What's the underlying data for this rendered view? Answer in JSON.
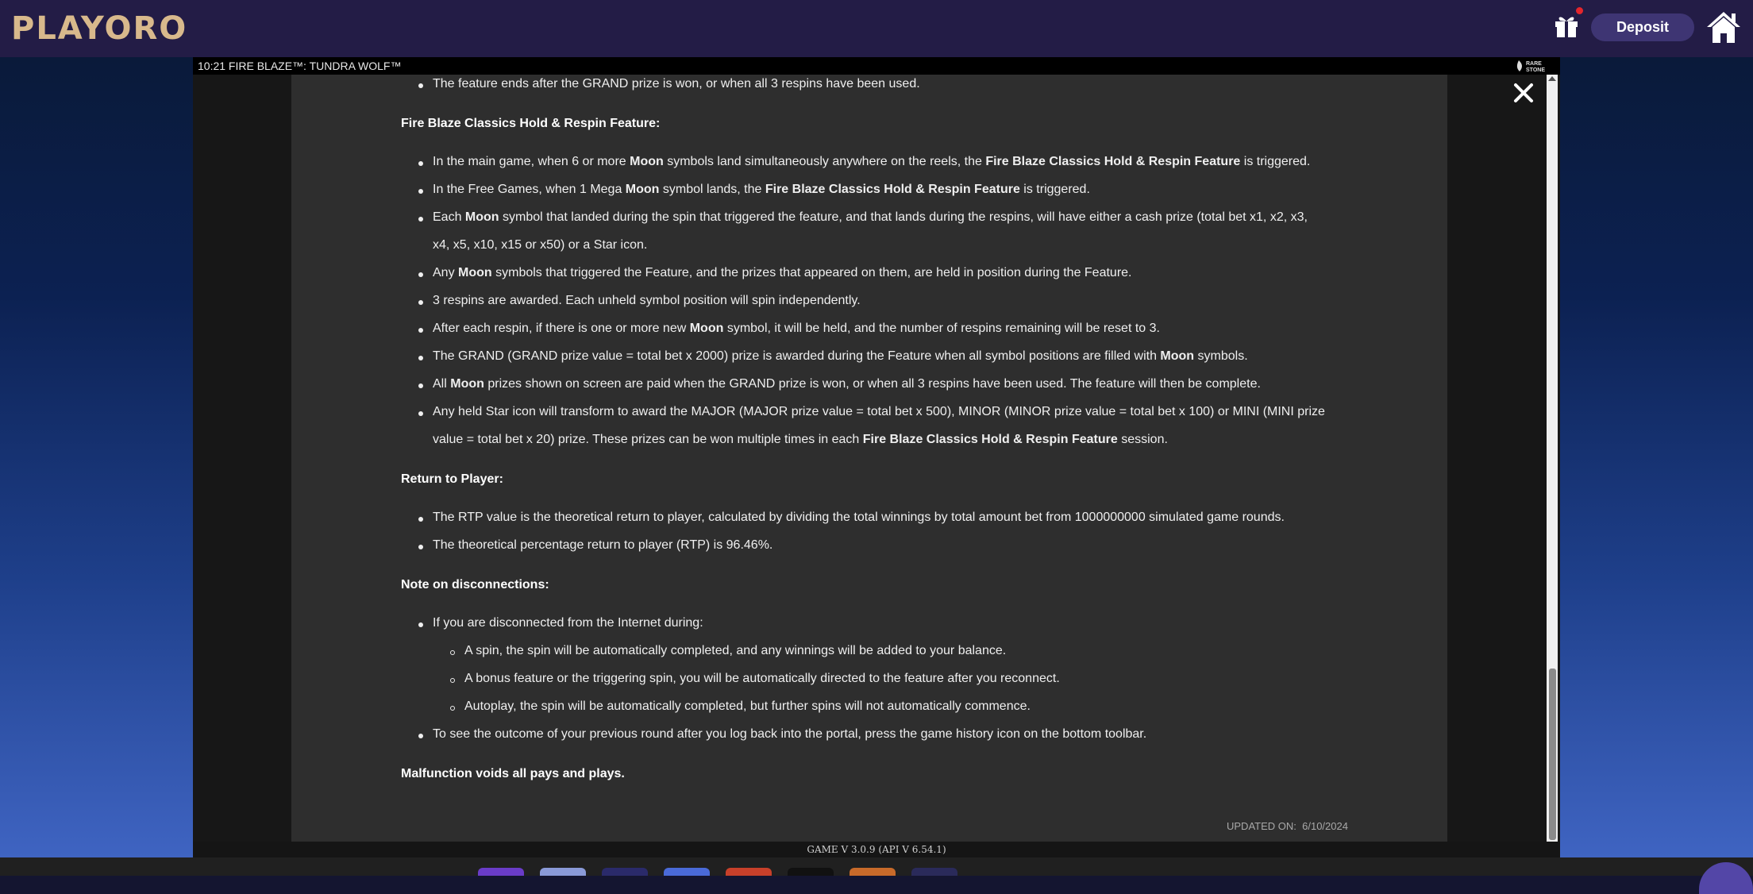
{
  "header": {
    "logo_text": "PLAYORO",
    "deposit_label": "Deposit",
    "icons": [
      "gift-icon",
      "home-icon",
      "notification-dot"
    ],
    "colors": {
      "topbar": "#231c46",
      "deposit_bg": "#3e3573",
      "logo": "#d8b98c",
      "notification": "#e4262c"
    }
  },
  "game": {
    "title_line": "10:21  FIRE BLAZE™: TUNDRA WOLF™",
    "provider_logo_text": "RARE STONE",
    "version": "GAME V 3.0.9 (API V 6.54.1)"
  },
  "rules": {
    "top_item": "The feature ends after the GRAND prize is won, or when all 3 respins have been used.",
    "section1": {
      "heading": "Fire Blaze Classics Hold & Respin Feature:",
      "items": [
        {
          "parts": [
            "In the main game, when 6 or more ",
            "Moon",
            " symbols land simultaneously anywhere on the reels, the ",
            "Fire Blaze Classics Hold & Respin Feature",
            " is triggered."
          ]
        },
        {
          "parts": [
            "In the Free Games, when 1 Mega ",
            "Moon",
            " symbol lands, the ",
            "Fire Blaze Classics Hold & Respin Feature",
            " is triggered."
          ]
        },
        {
          "parts": [
            "Each ",
            "Moon",
            " symbol that landed during the spin that triggered the feature, and that lands during the respins, will have either a cash prize (total bet x1, x2, x3,"
          ],
          "cont": "x4, x5, x10, x15 or x50) or a Star icon."
        },
        {
          "parts": [
            "Any ",
            "Moon",
            " symbols that triggered the Feature, and the prizes that appeared on them, are held in position during the Feature."
          ]
        },
        {
          "parts": [
            "3 respins are awarded. Each unheld symbol position will spin independently."
          ]
        },
        {
          "parts": [
            "After each respin, if there is one or more new ",
            "Moon",
            " symbol, it will be held, and the number of respins remaining will be reset to 3."
          ]
        },
        {
          "parts": [
            "The GRAND (GRAND prize value = total bet x 2000) prize is awarded during the Feature when all symbol positions are filled with ",
            "Moon",
            " symbols."
          ]
        },
        {
          "parts": [
            "All ",
            "Moon",
            " prizes shown on screen are paid when the GRAND prize is won, or when all 3 respins have been used. The feature will then be complete."
          ]
        },
        {
          "parts": [
            "Any held Star icon will transform to award the MAJOR (MAJOR prize value = total bet x 500), MINOR (MINOR prize value = total bet x 100) or MINI (MINI prize"
          ],
          "cont_parts": [
            "value = total bet x 20) prize. These prizes can be won multiple times in each ",
            "Fire Blaze Classics Hold & Respin Feature",
            " session."
          ]
        }
      ]
    },
    "section2": {
      "heading": "Return to Player:",
      "items": [
        "The RTP value is the theoretical return to player, calculated by dividing the total winnings by total amount bet from 1000000000 simulated game rounds.",
        "The theoretical percentage return to player (RTP) is 96.46%."
      ]
    },
    "section3": {
      "heading": "Note on disconnections:",
      "intro": "If you are disconnected from the Internet during:",
      "sub_items": [
        "A spin, the spin will be automatically completed, and any winnings will be added to your balance.",
        "A bonus feature or the triggering spin, you will be automatically directed to the feature after you reconnect.",
        "Autoplay, the spin will be automatically completed, but further spins will not automatically commence."
      ],
      "last_item": "To see the outcome of your previous round after you log back into the portal, press the game history icon on the bottom toolbar."
    },
    "closing": "Malfunction voids all pays and plays.",
    "updated_label": "UPDATED ON:",
    "updated_date": "6/10/2024"
  },
  "dock": {
    "thumb_colors": [
      "#6a3cc8",
      "#8a9ad8",
      "#2a2a6a",
      "#4a6ad8",
      "#c8402a",
      "#111111",
      "#c86a2a",
      "#2a2a5a"
    ]
  }
}
